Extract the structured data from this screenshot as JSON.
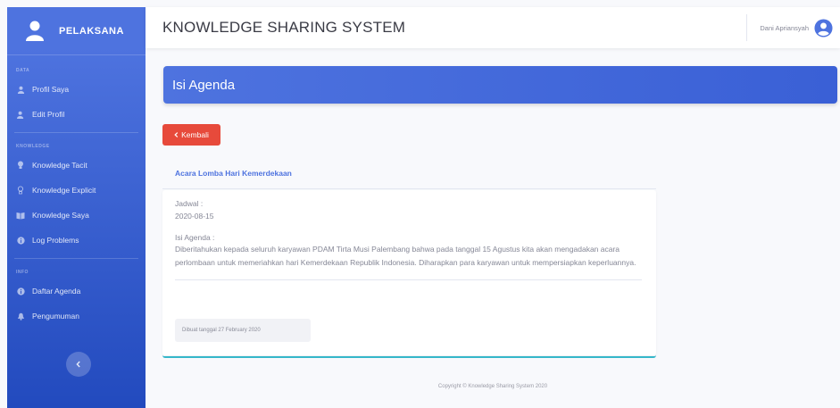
{
  "sidebar": {
    "brand": "PELAKSANA",
    "sections": [
      {
        "heading": "Data",
        "items": [
          {
            "label": "Profil Saya",
            "icon": "user-icon"
          },
          {
            "label": "Edit Profil",
            "icon": "user-edit-icon"
          }
        ]
      },
      {
        "heading": "Knowledge",
        "items": [
          {
            "label": "Knowledge Tacit",
            "icon": "lightbulb-icon"
          },
          {
            "label": "Knowledge Explicit",
            "icon": "lightbulb-outline-icon"
          },
          {
            "label": "Knowledge Saya",
            "icon": "book-icon"
          },
          {
            "label": "Log Problems",
            "icon": "info-icon"
          }
        ]
      },
      {
        "heading": "Info",
        "items": [
          {
            "label": "Daftar Agenda",
            "icon": "calendar-icon"
          },
          {
            "label": "Pengumuman",
            "icon": "bell-icon"
          }
        ]
      }
    ],
    "toggle_icon": "chevron-left-icon"
  },
  "topbar": {
    "title": "KNOWLEDGE SHARING SYSTEM",
    "user_name": "Dani Apriansyah",
    "avatar_icon": "user-circle-icon"
  },
  "page": {
    "title": "Isi Agenda",
    "back_label": "Kembali"
  },
  "agenda": {
    "title": "Acara Lomba Hari Kemerdekaan",
    "schedule_label": "Jadwal :",
    "schedule_value": "2020-08-15",
    "content_label": "Isi Agenda :",
    "content_text": "Diberitahukan kepada seluruh karyawan PDAM Tirta Musi Palembang bahwa pada tanggal 15 Agustus kita akan mengadakan acara perlombaan untuk memeriahkan hari Kemerdekaan Republik Indonesia. Diharapkan para karyawan untuk mempersiapkan keperluannya.",
    "created_text": "Dibuat tanggal 27 February 2020"
  },
  "footer": {
    "copyright": "Copyright © Knowledge Sharing System 2020"
  },
  "colors": {
    "primary": "#4e73df",
    "danger": "#e74a3b",
    "info": "#36b9cc"
  }
}
